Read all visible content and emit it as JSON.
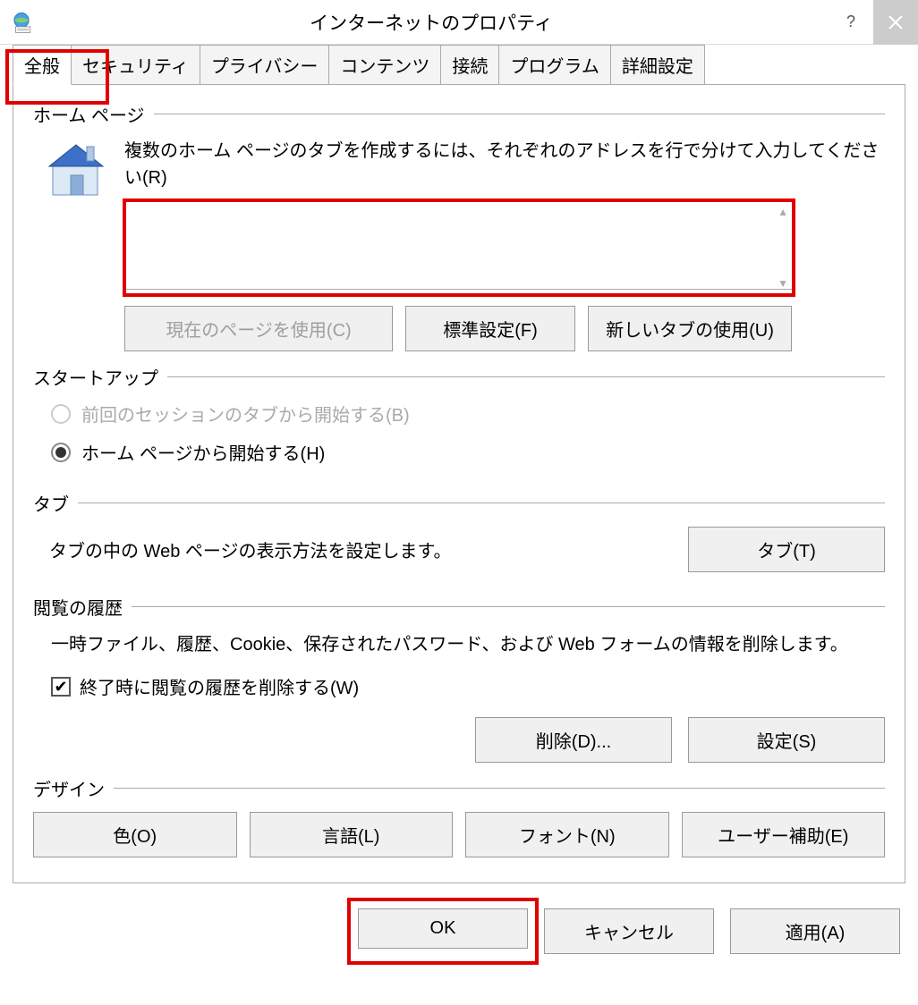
{
  "title": "インターネットのプロパティ",
  "tabs": [
    "全般",
    "セキュリティ",
    "プライバシー",
    "コンテンツ",
    "接続",
    "プログラム",
    "詳細設定"
  ],
  "homepage": {
    "legend": "ホーム ページ",
    "desc": "複数のホーム ページのタブを作成するには、それぞれのアドレスを行で分けて入力してください(R)",
    "textarea_value": "",
    "btn_current": "現在のページを使用(C)",
    "btn_default": "標準設定(F)",
    "btn_newtab": "新しいタブの使用(U)"
  },
  "startup": {
    "legend": "スタートアップ",
    "radio_prev": "前回のセッションのタブから開始する(B)",
    "radio_home": "ホーム ページから開始する(H)"
  },
  "tabs_section": {
    "legend": "タブ",
    "desc": "タブの中の Web ページの表示方法を設定します。",
    "btn": "タブ(T)"
  },
  "history": {
    "legend": "閲覧の履歴",
    "desc": "一時ファイル、履歴、Cookie、保存されたパスワード、および Web フォームの情報を削除します。",
    "cb_label": "終了時に閲覧の履歴を削除する(W)",
    "btn_delete": "削除(D)...",
    "btn_settings": "設定(S)"
  },
  "design": {
    "legend": "デザイン",
    "btn_color": "色(O)",
    "btn_lang": "言語(L)",
    "btn_font": "フォント(N)",
    "btn_access": "ユーザー補助(E)"
  },
  "footer": {
    "ok": "OK",
    "cancel": "キャンセル",
    "apply": "適用(A)"
  }
}
